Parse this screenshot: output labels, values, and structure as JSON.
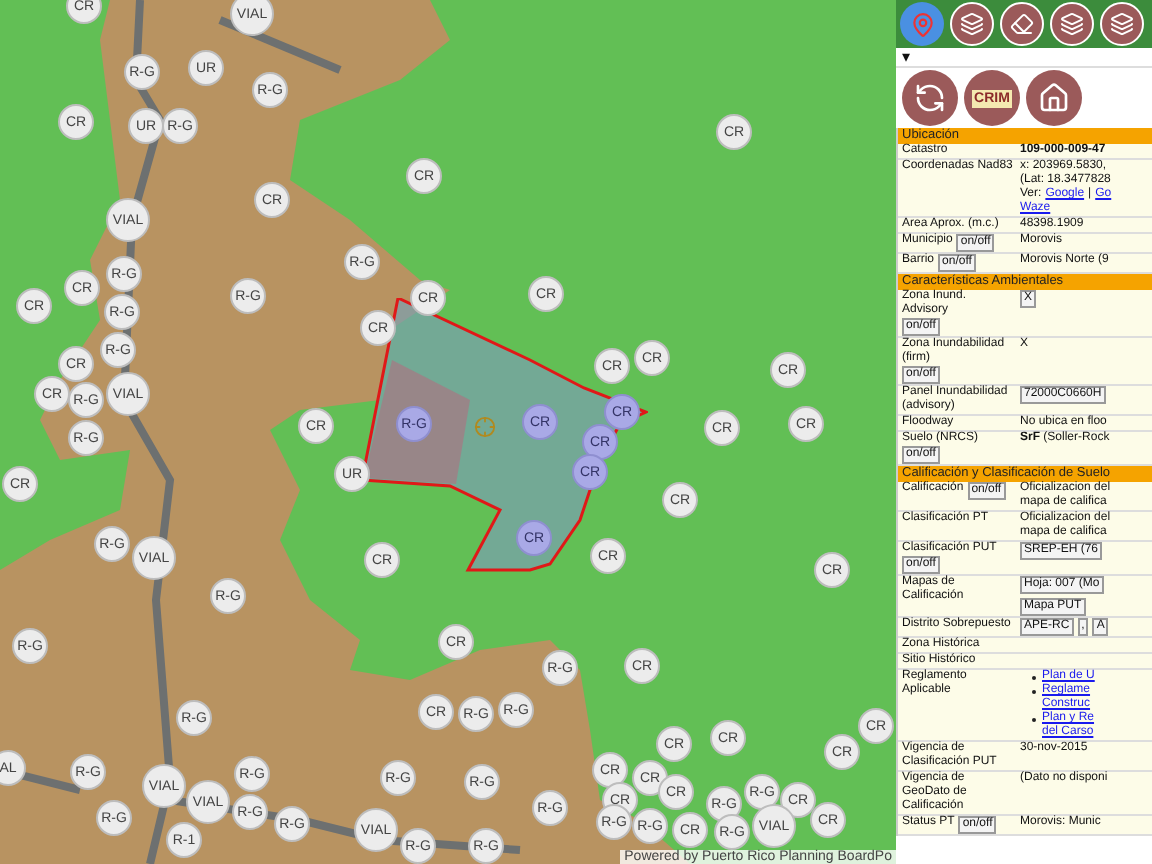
{
  "map": {
    "attribution": "Powered by Puerto Rico Planning BoardPo",
    "markers": [
      {
        "label": "VIAL",
        "selected": false
      },
      {
        "label": "CR",
        "selected": false
      },
      {
        "label": "R-G",
        "selected": false
      },
      {
        "label": "UR",
        "selected": false
      },
      {
        "label": "R-G",
        "selected": false
      },
      {
        "label": "CR",
        "selected": false
      },
      {
        "label": "UR",
        "selected": false
      },
      {
        "label": "R-G",
        "selected": false
      },
      {
        "label": "CR",
        "selected": false
      },
      {
        "label": "CR",
        "selected": false
      },
      {
        "label": "CR",
        "selected": false
      },
      {
        "label": "VIAL",
        "selected": false
      },
      {
        "label": "R-G",
        "selected": false
      },
      {
        "label": "CR",
        "selected": false
      },
      {
        "label": "R-G",
        "selected": false
      },
      {
        "label": "R-G",
        "selected": false
      },
      {
        "label": "CR",
        "selected": false
      },
      {
        "label": "CR",
        "selected": false
      },
      {
        "label": "CR",
        "selected": false
      },
      {
        "label": "R-G",
        "selected": false
      },
      {
        "label": "CR",
        "selected": false
      },
      {
        "label": "R-G",
        "selected": false
      },
      {
        "label": "CR",
        "selected": false
      },
      {
        "label": "CR",
        "selected": false
      },
      {
        "label": "CR",
        "selected": false
      },
      {
        "label": "CR",
        "selected": false
      },
      {
        "label": "CR",
        "selected": false
      },
      {
        "label": "R-G",
        "selected": false
      },
      {
        "label": "VIAL",
        "selected": false
      },
      {
        "label": "R-G",
        "selected": false
      },
      {
        "label": "R-G",
        "selected": true
      },
      {
        "label": "CR",
        "selected": true
      },
      {
        "label": "CR",
        "selected": true
      },
      {
        "label": "CR",
        "selected": false
      },
      {
        "label": "CR",
        "selected": false
      },
      {
        "label": "CR",
        "selected": false
      },
      {
        "label": "CR",
        "selected": true
      },
      {
        "label": "UR",
        "selected": false
      },
      {
        "label": "CR",
        "selected": true
      },
      {
        "label": "CR",
        "selected": false
      },
      {
        "label": "CR",
        "selected": false
      },
      {
        "label": "R-G",
        "selected": false
      },
      {
        "label": "VIAL",
        "selected": false
      },
      {
        "label": "CR",
        "selected": true
      },
      {
        "label": "CR",
        "selected": false
      },
      {
        "label": "CR",
        "selected": false
      },
      {
        "label": "CR",
        "selected": false
      },
      {
        "label": "R-G",
        "selected": false
      },
      {
        "label": "R-G",
        "selected": false
      },
      {
        "label": "CR",
        "selected": false
      },
      {
        "label": "R-G",
        "selected": false
      },
      {
        "label": "CR",
        "selected": false
      },
      {
        "label": "CR",
        "selected": false
      },
      {
        "label": "R-G",
        "selected": false
      },
      {
        "label": "R-G",
        "selected": false
      },
      {
        "label": "R-G",
        "selected": false
      },
      {
        "label": "CR",
        "selected": false
      },
      {
        "label": "CR",
        "selected": false
      },
      {
        "label": "CR",
        "selected": false
      },
      {
        "label": "CR",
        "selected": false
      },
      {
        "label": "CR",
        "selected": false
      },
      {
        "label": "CR",
        "selected": false
      },
      {
        "label": "R-G",
        "selected": false
      },
      {
        "label": "AL",
        "selected": false
      },
      {
        "label": "VIAL",
        "selected": false
      },
      {
        "label": "R-G",
        "selected": false
      },
      {
        "label": "R-G",
        "selected": false
      },
      {
        "label": "R-G",
        "selected": false
      },
      {
        "label": "R-G",
        "selected": false
      },
      {
        "label": "VIAL",
        "selected": false
      },
      {
        "label": "R-G",
        "selected": false
      },
      {
        "label": "R-G",
        "selected": false
      },
      {
        "label": "R-G",
        "selected": false
      },
      {
        "label": "CR",
        "selected": false
      },
      {
        "label": "CR",
        "selected": false
      },
      {
        "label": "R-G",
        "selected": false
      },
      {
        "label": "R-G",
        "selected": false
      },
      {
        "label": "CR",
        "selected": false
      },
      {
        "label": "VIAL",
        "selected": false
      },
      {
        "label": "R-G",
        "selected": false
      },
      {
        "label": "R-G",
        "selected": false
      },
      {
        "label": "R-1",
        "selected": false
      },
      {
        "label": "R-G",
        "selected": false
      },
      {
        "label": "R-G",
        "selected": false
      },
      {
        "label": "CR",
        "selected": false
      },
      {
        "label": "R-G",
        "selected": false
      },
      {
        "label": "VIAL",
        "selected": false
      },
      {
        "label": "CR",
        "selected": false
      }
    ]
  },
  "toolbar": {
    "dropdown": "▾"
  },
  "logo": "CRIM",
  "panel": {
    "sections": [
      {
        "title": "Ubicación",
        "rows": [
          {
            "label": "Catastro",
            "value": {
              "kind": "bold",
              "text": "109-000-009-47"
            }
          },
          {
            "label": "Coordenadas Nad83",
            "value": {
              "kind": "lines",
              "lines": [
                [
                  {
                    "text": "x: 203969.5830,",
                    "link": false
                  }
                ],
                [
                  {
                    "text": "(Lat: 18.3477828",
                    "link": false
                  }
                ],
                [
                  {
                    "text": "Ver:",
                    "link": false
                  },
                  {
                    "text": "Google",
                    "link": true
                  },
                  {
                    "text": "|",
                    "link": false
                  },
                  {
                    "text": "Go",
                    "link": true
                  }
                ],
                [
                  {
                    "text": "Waze",
                    "link": true
                  }
                ]
              ]
            }
          },
          {
            "label": "Area Aprox. (m.c.)",
            "value": {
              "kind": "text",
              "text": "48398.1909"
            }
          },
          {
            "label": "Municipio",
            "toggle": "on/off",
            "value": {
              "kind": "text",
              "text": "Morovis"
            }
          },
          {
            "label": "Barrio",
            "toggle": "on/off",
            "value": {
              "kind": "text",
              "text": "Morovis Norte (9"
            }
          }
        ]
      },
      {
        "title": "Características Ambientales",
        "rows": [
          {
            "label": "Zona Inund. Advisory",
            "toggle": "on/off",
            "value": {
              "kind": "buttons",
              "buttons": [
                "X"
              ]
            }
          },
          {
            "label": "Zona Inundabilidad (firm)",
            "toggle": "on/off",
            "value": {
              "kind": "text",
              "text": "X"
            }
          },
          {
            "label": "Panel Inundabilidad (advisory)",
            "value": {
              "kind": "buttons",
              "buttons": [
                "72000C0660H"
              ]
            }
          },
          {
            "label": "Floodway",
            "value": {
              "kind": "text",
              "text": "No ubica en floo"
            }
          },
          {
            "label": "Suelo (NRCS)",
            "toggle": "on/off",
            "value": {
              "kind": "lines",
              "lines": [
                [
                  {
                    "text": "**SrF** (Soller-Rock",
                    "link": false
                  }
                ]
              ]
            }
          }
        ]
      },
      {
        "title": "Calificación y Clasificación de Suelo",
        "rows": [
          {
            "label": "Calificación",
            "toggle": "on/off",
            "value": {
              "kind": "lines",
              "lines": [
                [
                  {
                    "text": "Oficializacion del",
                    "link": false
                  }
                ],
                [
                  {
                    "text": "mapa de califica",
                    "link": false
                  }
                ]
              ]
            }
          },
          {
            "label": "Clasificación PT",
            "value": {
              "kind": "lines",
              "lines": [
                [
                  {
                    "text": "Oficializacion del",
                    "link": false
                  }
                ],
                [
                  {
                    "text": "mapa de califica",
                    "link": false
                  }
                ]
              ]
            }
          },
          {
            "label": "Clasificación PUT",
            "toggle": "on/off",
            "value": {
              "kind": "buttons",
              "buttons": [
                "SREP-EH (76"
              ]
            }
          },
          {
            "label": "Mapas de Calificación",
            "value": {
              "kind": "buttons",
              "buttons": [
                "Hoja: 007 (Mo",
                "Mapa PUT"
              ]
            }
          },
          {
            "label": "Distrito Sobrepuesto",
            "value": {
              "kind": "buttons",
              "buttons": [
                "APE-RC",
                ",",
                "A"
              ]
            }
          },
          {
            "label": "Zona Histórica"
          },
          {
            "label": "Sitio Histórico"
          },
          {
            "label": "Reglamento Aplicable",
            "value": {
              "kind": "list",
              "items": [
                [
                  "Plan de U"
                ],
                [
                  "Reglame",
                  "Construc"
                ],
                [
                  "Plan y Re",
                  "del Carso"
                ]
              ]
            }
          },
          {
            "label": "Vigencia de Clasificación PUT",
            "value": {
              "kind": "text",
              "text": "30-nov-2015"
            }
          },
          {
            "label": "Vigencia de GeoDato de Calificación",
            "value": {
              "kind": "text",
              "text": "(Dato no disponi"
            }
          },
          {
            "label": "Status PT",
            "toggle": "on/off",
            "value": {
              "kind": "text",
              "text": "Morovis: Munic"
            }
          }
        ]
      }
    ]
  }
}
